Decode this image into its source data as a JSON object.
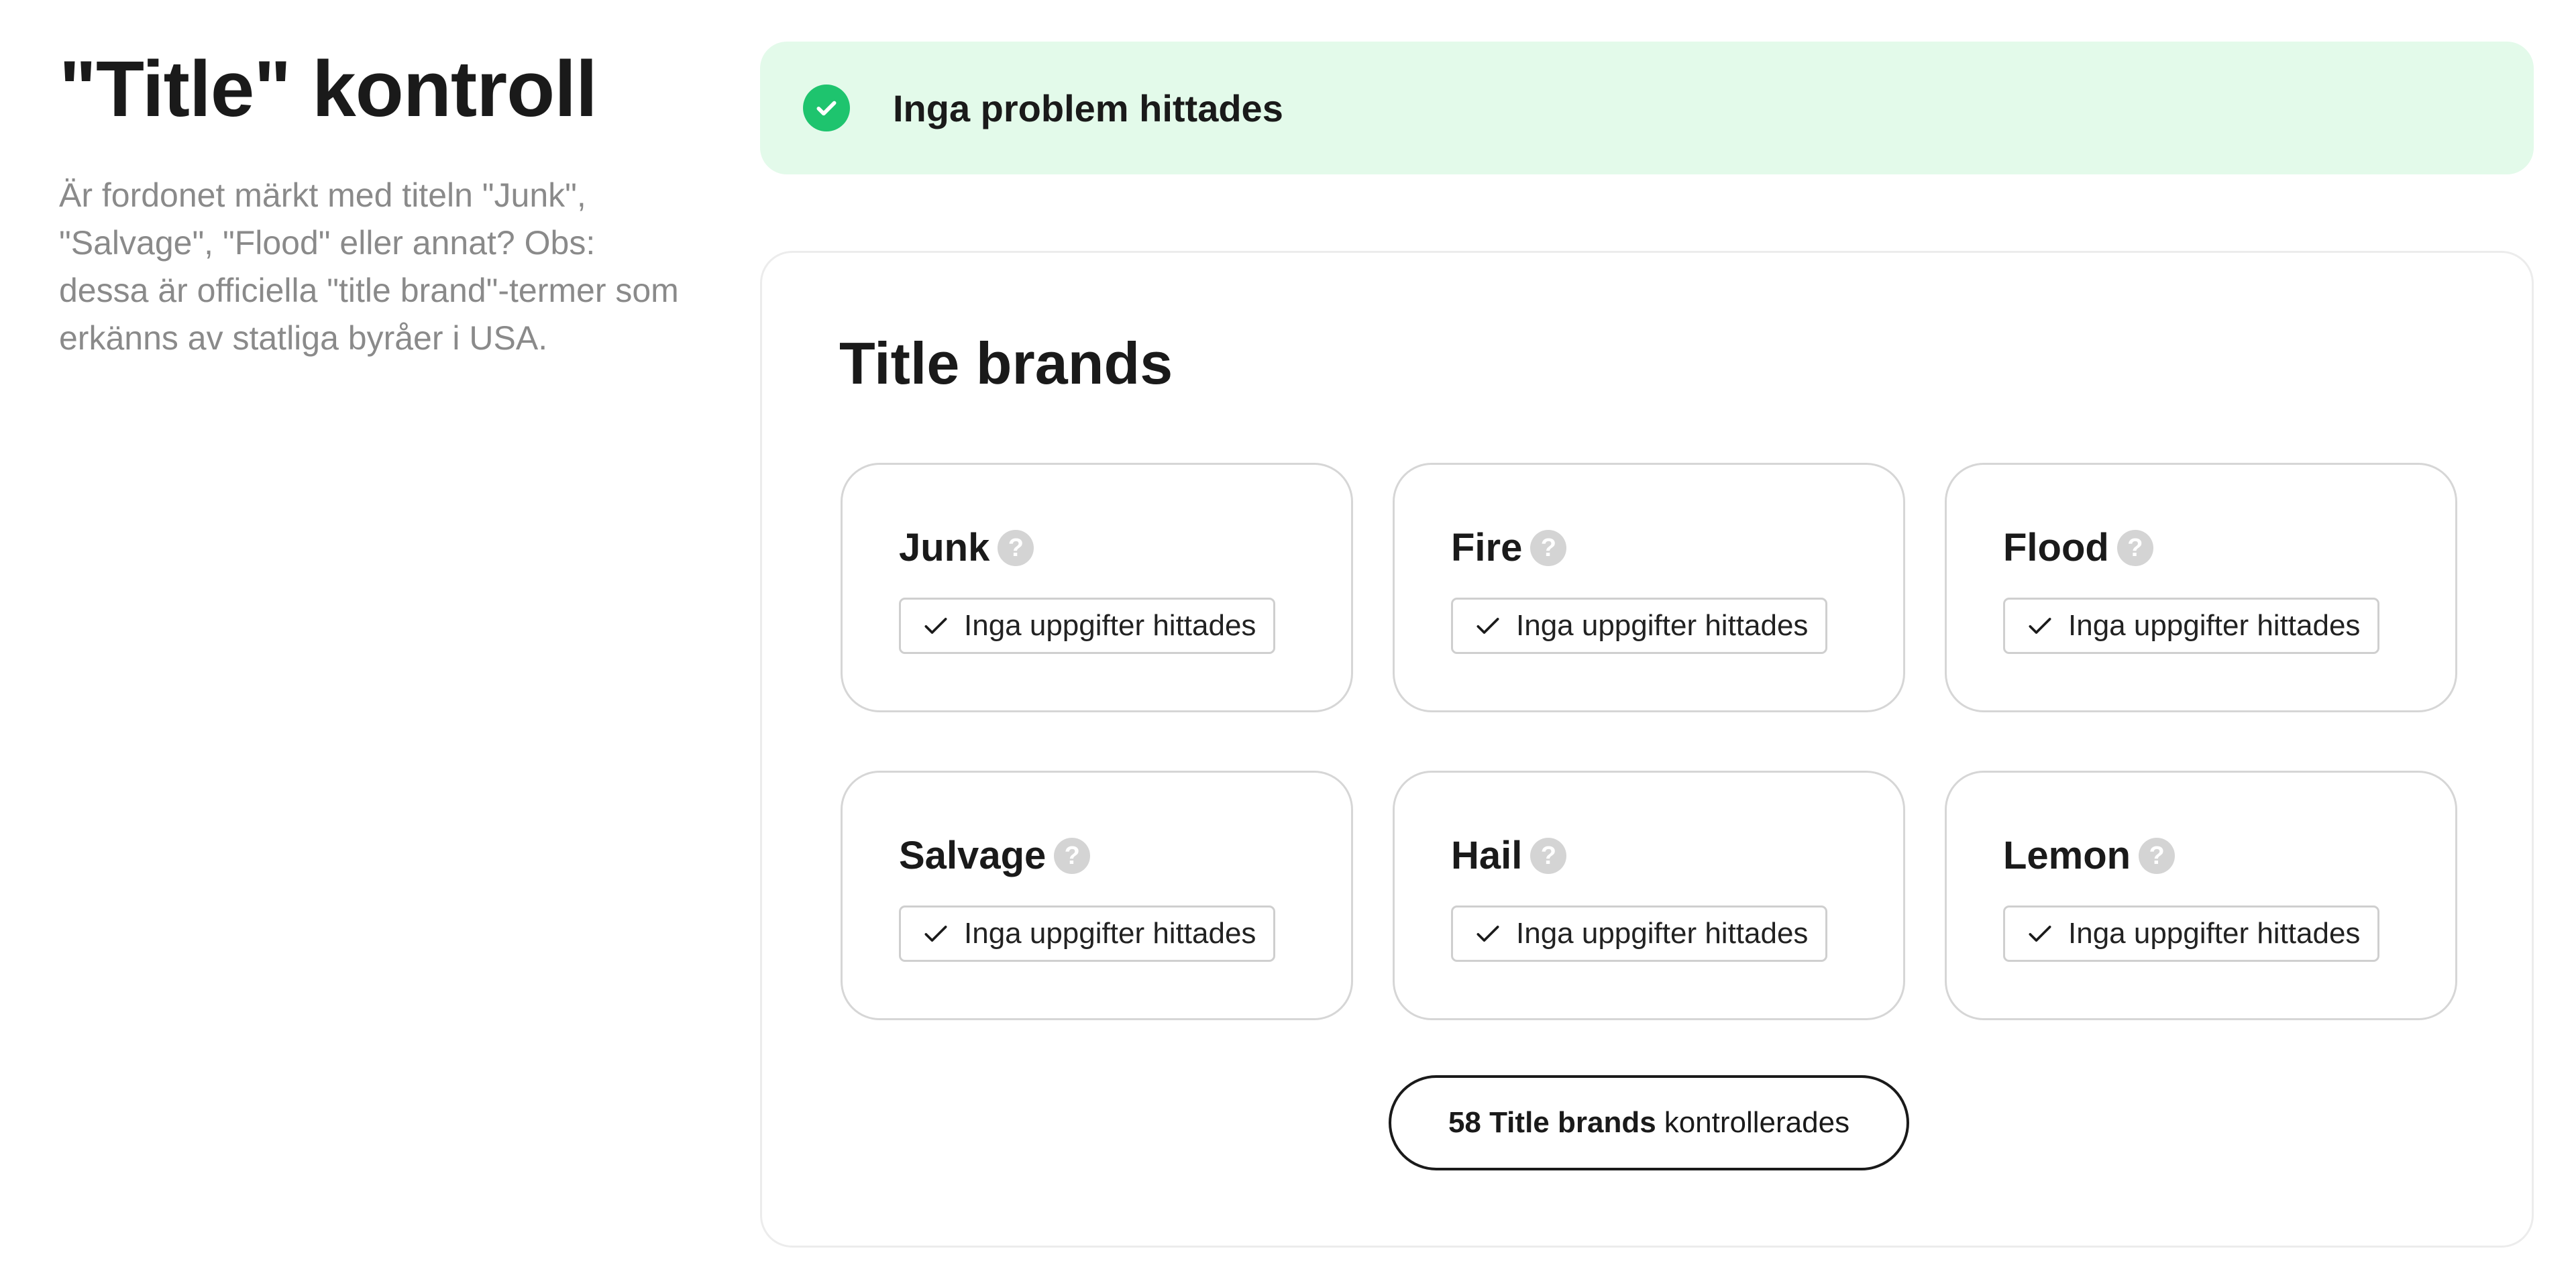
{
  "intro": {
    "title": "\"Title\" kontroll",
    "description": "Är fordonet märkt med titeln \"Junk\", \"Salvage\", \"Flood\" eller annat? Obs: dessa är officiella \"title brand\"-termer som erkänns av statliga byråer i USA."
  },
  "status": {
    "icon": "check-circle-icon",
    "text": "Inga problem hittades",
    "color": "#1ec46e",
    "background": "#e3faea"
  },
  "section": {
    "title": "Title brands",
    "brands": [
      {
        "name": "Junk",
        "help_icon": "question-icon",
        "help_glyph": "?",
        "result_icon": "check-icon",
        "result": "Inga uppgifter hittades"
      },
      {
        "name": "Fire",
        "help_icon": "question-icon",
        "help_glyph": "?",
        "result_icon": "check-icon",
        "result": "Inga uppgifter hittades"
      },
      {
        "name": "Flood",
        "help_icon": "question-icon",
        "help_glyph": "?",
        "result_icon": "check-icon",
        "result": "Inga uppgifter hittades"
      },
      {
        "name": "Salvage",
        "help_icon": "question-icon",
        "help_glyph": "?",
        "result_icon": "check-icon",
        "result": "Inga uppgifter hittades"
      },
      {
        "name": "Hail",
        "help_icon": "question-icon",
        "help_glyph": "?",
        "result_icon": "check-icon",
        "result": "Inga uppgifter hittades"
      },
      {
        "name": "Lemon",
        "help_icon": "question-icon",
        "help_glyph": "?",
        "result_icon": "check-icon",
        "result": "Inga uppgifter hittades"
      }
    ],
    "summary": {
      "count_label": "58 Title brands",
      "rest_label": "kontrollerades"
    }
  }
}
